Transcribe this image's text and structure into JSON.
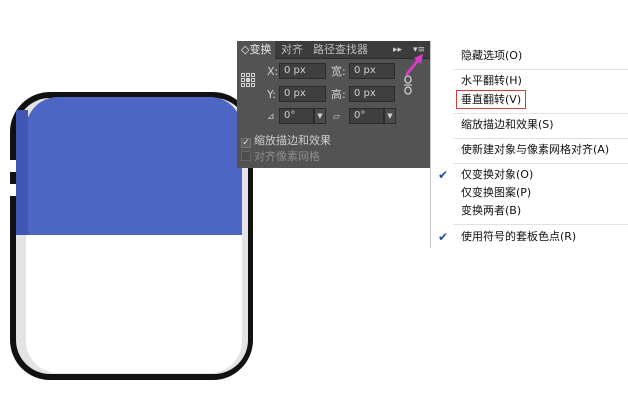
{
  "colors": {
    "panel_bg": "#535353",
    "panel_tab_bg": "#3c3c3c",
    "icon_top": "#4d66c4",
    "icon_outline": "#111111",
    "menu_highlight_border": "#d43c3c",
    "arrow": "#d63cc8"
  },
  "panel": {
    "tabs": [
      {
        "label": "◇变换",
        "active": true
      },
      {
        "label": "对齐",
        "active": false
      },
      {
        "label": "路径查找器",
        "active": false
      }
    ],
    "menu_arrows": "▸▸",
    "menu_button": "▾≡",
    "x": {
      "label": "X:",
      "value": "0 px"
    },
    "y": {
      "label": "Y:",
      "value": "0 px"
    },
    "width": {
      "label": "宽:",
      "value": "0 px"
    },
    "height": {
      "label": "高:",
      "value": "0 px"
    },
    "rotate": {
      "value": "0°"
    },
    "shear": {
      "value": "0°"
    },
    "options": [
      {
        "label": "缩放描边和效果",
        "checked": true,
        "enabled": true
      },
      {
        "label": "对齐像素网格",
        "checked": false,
        "enabled": false
      }
    ]
  },
  "menu": {
    "items": [
      {
        "label": "隐藏选项(O)",
        "checked": false
      },
      {
        "label": "水平翻转(H)",
        "checked": false
      },
      {
        "label": "垂直翻转(V)",
        "checked": false,
        "highlighted": true
      },
      {
        "label": "缩放描边和效果(S)",
        "checked": false
      },
      {
        "label": "使新建对象与像素网格对齐(A)",
        "checked": false
      },
      {
        "label": "仅变换对象(O)",
        "checked": true
      },
      {
        "label": "仅变换图案(P)",
        "checked": false
      },
      {
        "label": "变换两者(B)",
        "checked": false
      },
      {
        "label": "使用符号的套板色点(R)",
        "checked": true
      }
    ]
  }
}
